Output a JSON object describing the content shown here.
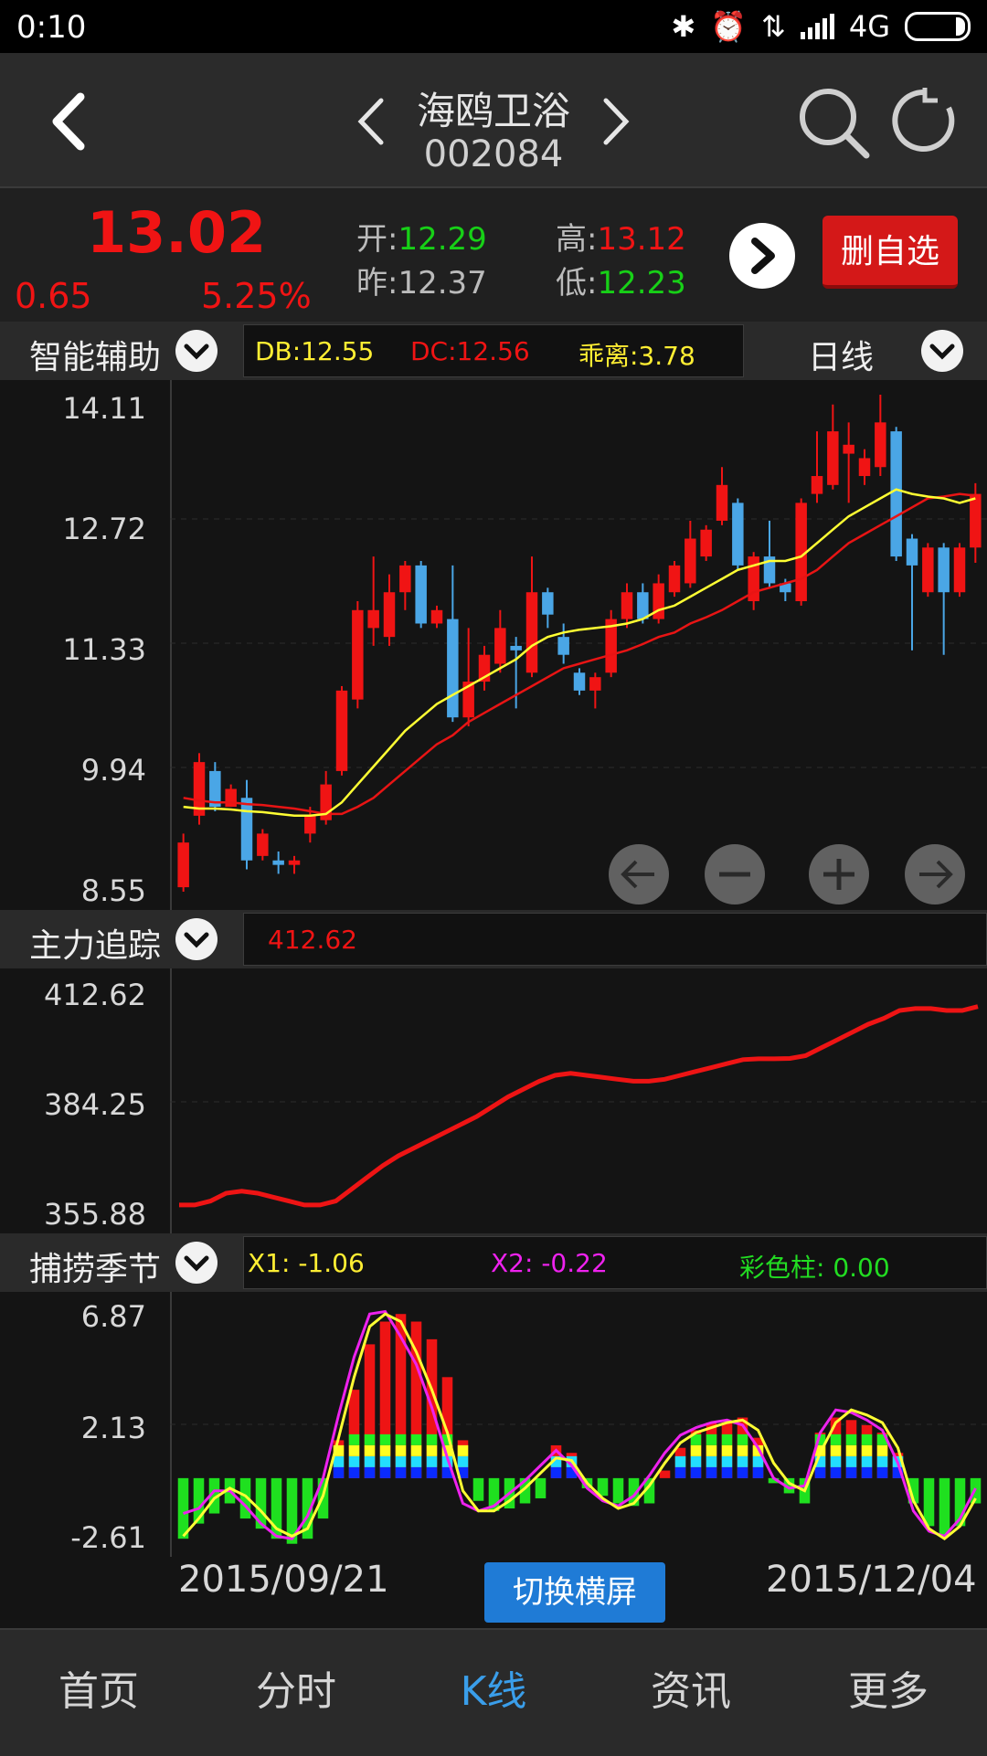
{
  "status_bar": {
    "time": "0:10",
    "network": "4G"
  },
  "header": {
    "stock_name": "海鸥卫浴",
    "stock_code": "002084"
  },
  "quote": {
    "price": "13.02",
    "change": "0.65",
    "change_pct": "5.25%",
    "open_label": "开:",
    "open": "12.29",
    "prev_label": "昨:",
    "prev": "12.37",
    "high_label": "高:",
    "high": "13.12",
    "low_label": "低:",
    "low": "12.23",
    "delete_button": "删自选"
  },
  "kline_header": {
    "label": "智能辅助",
    "db": "DB:12.55",
    "dc": "DC:12.56",
    "deviation": "乖离:3.78",
    "period": "日线"
  },
  "kline": {
    "y_ticks": [
      "14.11",
      "12.72",
      "11.33",
      "9.94",
      "8.55"
    ],
    "ylim": [
      8.55,
      14.11
    ],
    "candles": [
      {
        "o": 8.6,
        "c": 9.1,
        "h": 9.2,
        "l": 8.55,
        "up": true
      },
      {
        "o": 9.4,
        "c": 10.0,
        "h": 10.1,
        "l": 9.3,
        "up": true
      },
      {
        "o": 9.9,
        "c": 9.5,
        "h": 10.0,
        "l": 9.45,
        "up": false
      },
      {
        "o": 9.5,
        "c": 9.7,
        "h": 9.75,
        "l": 9.5,
        "up": true
      },
      {
        "o": 9.6,
        "c": 8.9,
        "h": 9.8,
        "l": 8.8,
        "up": false
      },
      {
        "o": 8.95,
        "c": 9.2,
        "h": 9.25,
        "l": 8.9,
        "up": true
      },
      {
        "o": 8.9,
        "c": 8.85,
        "h": 9.0,
        "l": 8.75,
        "up": false
      },
      {
        "o": 8.85,
        "c": 8.9,
        "h": 8.95,
        "l": 8.75,
        "up": true
      },
      {
        "o": 9.2,
        "c": 9.4,
        "h": 9.5,
        "l": 9.1,
        "up": true
      },
      {
        "o": 9.35,
        "c": 9.75,
        "h": 9.9,
        "l": 9.3,
        "up": true
      },
      {
        "o": 9.9,
        "c": 10.8,
        "h": 10.85,
        "l": 9.85,
        "up": true
      },
      {
        "o": 10.7,
        "c": 11.7,
        "h": 11.8,
        "l": 10.6,
        "up": true
      },
      {
        "o": 11.5,
        "c": 11.7,
        "h": 12.3,
        "l": 11.3,
        "up": true
      },
      {
        "o": 11.4,
        "c": 11.9,
        "h": 12.1,
        "l": 11.3,
        "up": true
      },
      {
        "o": 11.9,
        "c": 12.2,
        "h": 12.25,
        "l": 11.7,
        "up": true
      },
      {
        "o": 12.2,
        "c": 11.55,
        "h": 12.25,
        "l": 11.5,
        "up": false
      },
      {
        "o": 11.55,
        "c": 11.7,
        "h": 11.75,
        "l": 11.5,
        "up": true
      },
      {
        "o": 11.6,
        "c": 10.5,
        "h": 12.2,
        "l": 10.45,
        "up": false
      },
      {
        "o": 10.5,
        "c": 10.9,
        "h": 11.5,
        "l": 10.4,
        "up": true
      },
      {
        "o": 10.9,
        "c": 11.2,
        "h": 11.3,
        "l": 10.8,
        "up": true
      },
      {
        "o": 11.1,
        "c": 11.5,
        "h": 11.7,
        "l": 11.0,
        "up": true
      },
      {
        "o": 11.3,
        "c": 11.25,
        "h": 11.4,
        "l": 10.6,
        "up": false
      },
      {
        "o": 11.0,
        "c": 11.9,
        "h": 12.3,
        "l": 10.95,
        "up": true
      },
      {
        "o": 11.9,
        "c": 11.65,
        "h": 11.95,
        "l": 11.5,
        "up": false
      },
      {
        "o": 11.4,
        "c": 11.2,
        "h": 11.55,
        "l": 11.1,
        "up": false
      },
      {
        "o": 11.0,
        "c": 10.8,
        "h": 11.05,
        "l": 10.75,
        "up": false
      },
      {
        "o": 10.8,
        "c": 10.95,
        "h": 11.0,
        "l": 10.6,
        "up": true
      },
      {
        "o": 11.0,
        "c": 11.6,
        "h": 11.7,
        "l": 10.95,
        "up": true
      },
      {
        "o": 11.6,
        "c": 11.9,
        "h": 12.0,
        "l": 11.5,
        "up": true
      },
      {
        "o": 11.9,
        "c": 11.6,
        "h": 12.0,
        "l": 11.55,
        "up": false
      },
      {
        "o": 11.6,
        "c": 12.0,
        "h": 12.1,
        "l": 11.55,
        "up": true
      },
      {
        "o": 11.9,
        "c": 12.2,
        "h": 12.25,
        "l": 11.85,
        "up": true
      },
      {
        "o": 12.0,
        "c": 12.5,
        "h": 12.7,
        "l": 11.95,
        "up": true
      },
      {
        "o": 12.3,
        "c": 12.6,
        "h": 12.65,
        "l": 12.25,
        "up": true
      },
      {
        "o": 12.7,
        "c": 13.1,
        "h": 13.3,
        "l": 12.65,
        "up": true
      },
      {
        "o": 12.9,
        "c": 12.2,
        "h": 12.95,
        "l": 12.15,
        "up": false
      },
      {
        "o": 11.8,
        "c": 12.3,
        "h": 12.35,
        "l": 11.7,
        "up": true
      },
      {
        "o": 12.3,
        "c": 12.0,
        "h": 12.7,
        "l": 11.95,
        "up": false
      },
      {
        "o": 12.0,
        "c": 11.9,
        "h": 12.05,
        "l": 11.8,
        "up": false
      },
      {
        "o": 11.8,
        "c": 12.9,
        "h": 12.95,
        "l": 11.75,
        "up": true
      },
      {
        "o": 13.0,
        "c": 13.2,
        "h": 13.7,
        "l": 12.9,
        "up": true
      },
      {
        "o": 13.1,
        "c": 13.7,
        "h": 14.0,
        "l": 13.05,
        "up": true
      },
      {
        "o": 13.45,
        "c": 13.55,
        "h": 13.8,
        "l": 12.9,
        "up": true
      },
      {
        "o": 13.2,
        "c": 13.4,
        "h": 13.5,
        "l": 13.1,
        "up": true
      },
      {
        "o": 13.3,
        "c": 13.8,
        "h": 14.11,
        "l": 13.2,
        "up": true
      },
      {
        "o": 13.7,
        "c": 12.3,
        "h": 13.75,
        "l": 12.25,
        "up": false
      },
      {
        "o": 12.5,
        "c": 12.2,
        "h": 12.55,
        "l": 11.25,
        "up": false
      },
      {
        "o": 11.9,
        "c": 12.4,
        "h": 12.45,
        "l": 11.85,
        "up": true
      },
      {
        "o": 12.4,
        "c": 11.9,
        "h": 12.45,
        "l": 11.2,
        "up": false
      },
      {
        "o": 11.9,
        "c": 12.4,
        "h": 12.45,
        "l": 11.85,
        "up": true
      },
      {
        "o": 12.4,
        "c": 13.0,
        "h": 13.12,
        "l": 12.23,
        "up": true
      }
    ],
    "ma_yellow": [
      9.5,
      9.48,
      9.48,
      9.47,
      9.45,
      9.44,
      9.42,
      9.4,
      9.4,
      9.42,
      9.55,
      9.75,
      9.95,
      10.15,
      10.35,
      10.5,
      10.65,
      10.75,
      10.85,
      10.95,
      11.05,
      11.15,
      11.3,
      11.4,
      11.45,
      11.48,
      11.5,
      11.52,
      11.55,
      11.6,
      11.7,
      11.75,
      11.85,
      11.95,
      12.05,
      12.15,
      12.2,
      12.25,
      12.25,
      12.3,
      12.45,
      12.6,
      12.75,
      12.85,
      12.95,
      13.05,
      13.0,
      12.97,
      12.95,
      12.9,
      12.95
    ],
    "ma_red": [
      9.6,
      9.57,
      9.55,
      9.55,
      9.53,
      9.52,
      9.5,
      9.48,
      9.45,
      9.42,
      9.42,
      9.5,
      9.6,
      9.75,
      9.9,
      10.05,
      10.2,
      10.3,
      10.45,
      10.55,
      10.65,
      10.75,
      10.85,
      10.95,
      11.05,
      11.1,
      11.15,
      11.2,
      11.25,
      11.32,
      11.4,
      11.45,
      11.55,
      11.62,
      11.7,
      11.8,
      11.9,
      11.95,
      12.0,
      12.05,
      12.15,
      12.3,
      12.45,
      12.55,
      12.65,
      12.75,
      12.85,
      12.95,
      12.97,
      13.0,
      12.98
    ]
  },
  "main_force": {
    "label": "主力追踪",
    "value": "412.62",
    "y_ticks": [
      "412.62",
      "384.25",
      "355.88"
    ],
    "ylim": [
      355.88,
      412.62
    ],
    "values": [
      358,
      358,
      359,
      361,
      361.5,
      361,
      360,
      359,
      358,
      358,
      359,
      362,
      365,
      368,
      370.5,
      372.5,
      374.5,
      376.5,
      378.5,
      380.5,
      383,
      385.5,
      387.5,
      389.5,
      391,
      391.5,
      391,
      390.5,
      390,
      389.5,
      389.5,
      390,
      391,
      392,
      393,
      394,
      395,
      395.2,
      395.2,
      395.3,
      396,
      398,
      400,
      402,
      404,
      405.5,
      407.5,
      408,
      408,
      407.5,
      407.5,
      408.5
    ]
  },
  "season": {
    "label": "捕捞季节",
    "x1": "X1: -1.06",
    "x2": "X2: -0.22",
    "color_bar": "彩色柱: 0.00",
    "y_ticks": [
      "6.87",
      "2.13",
      "-2.61"
    ],
    "ylim": [
      -2.61,
      6.87
    ],
    "bars": [
      -2.4,
      -1.8,
      -1.4,
      -1.0,
      -1.6,
      -2.0,
      -2.4,
      -2.6,
      -2.4,
      -1.6,
      1.5,
      3.5,
      5.3,
      6.2,
      6.5,
      6.2,
      5.5,
      4.0,
      1.5,
      -0.9,
      -1.3,
      -1.2,
      -1.0,
      -0.8,
      1.3,
      1.0,
      -0.4,
      -0.7,
      -1.0,
      -1.1,
      -1.0,
      0.3,
      1.2,
      1.9,
      2.2,
      2.2,
      2.4,
      1.6,
      -0.2,
      -0.6,
      -1.0,
      1.8,
      2.4,
      2.3,
      2.1,
      1.8,
      1.0,
      -1.0,
      -1.9,
      -2.3,
      -1.9,
      -1.0
    ],
    "line_yellow": [
      -2.3,
      -1.6,
      -0.8,
      -0.4,
      -0.7,
      -1.3,
      -2.0,
      -2.3,
      -2.0,
      -0.7,
      1.6,
      4.0,
      6.0,
      6.5,
      6.2,
      5.0,
      3.5,
      1.8,
      -0.5,
      -1.3,
      -1.3,
      -0.9,
      -0.4,
      0.2,
      0.8,
      0.7,
      -0.2,
      -0.8,
      -1.2,
      -1.0,
      -0.3,
      0.6,
      1.4,
      1.8,
      2.0,
      2.2,
      2.3,
      1.9,
      0.6,
      -0.2,
      -0.5,
      1.0,
      2.2,
      2.7,
      2.5,
      2.2,
      1.2,
      -0.9,
      -2.0,
      -2.4,
      -1.9,
      -0.8
    ],
    "line_magenta": [
      -1.4,
      -1.2,
      -0.5,
      -0.5,
      -1.1,
      -1.8,
      -2.3,
      -2.4,
      -1.5,
      0.0,
      2.5,
      4.8,
      6.5,
      6.6,
      5.6,
      4.5,
      2.8,
      0.8,
      -1.0,
      -1.3,
      -1.1,
      -0.6,
      -0.1,
      0.5,
      1.1,
      0.5,
      -0.4,
      -0.9,
      -1.1,
      -0.7,
      0.1,
      1.0,
      1.7,
      2.0,
      2.2,
      2.3,
      2.1,
      1.2,
      0.0,
      -0.4,
      -0.3,
      1.8,
      2.7,
      2.6,
      2.3,
      1.9,
      0.6,
      -1.3,
      -2.1,
      -2.3,
      -1.6,
      -0.4
    ]
  },
  "date_start": "2015/09/21",
  "date_end": "2015/12/04",
  "switch_button": "切换横屏",
  "nav": [
    "首页",
    "分时",
    "K线",
    "资讯",
    "更多"
  ],
  "colors": {
    "up": "#f01414",
    "down": "#4aa6e6",
    "ma1": "#ffff33",
    "ma2": "#e81414",
    "accent": "#3a9eea"
  }
}
